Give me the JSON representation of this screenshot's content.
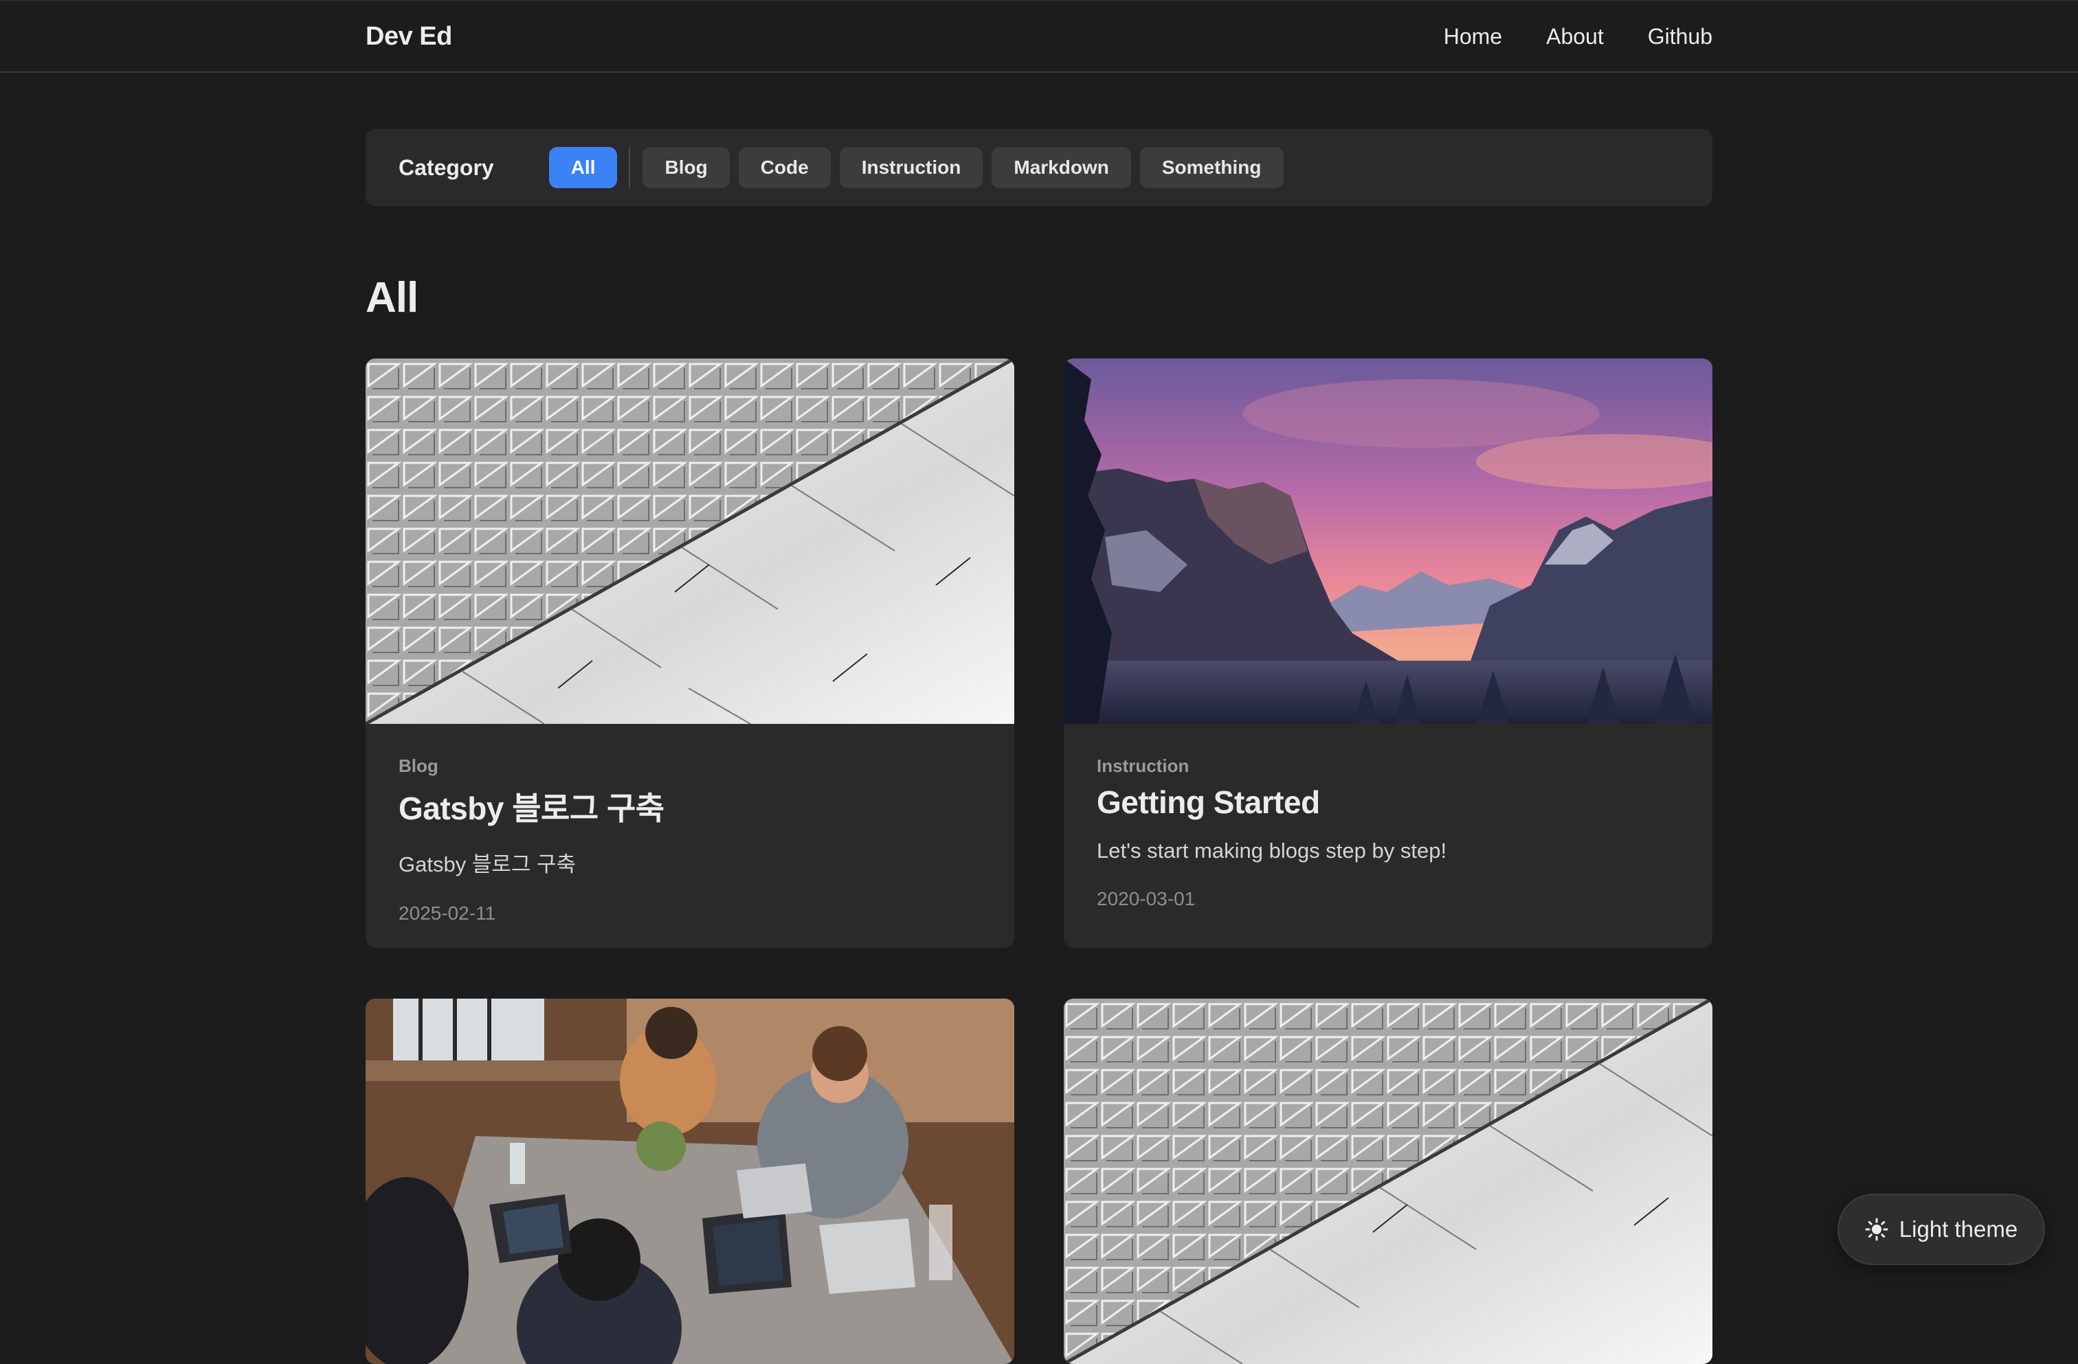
{
  "header": {
    "brand": "Dev Ed",
    "nav": [
      "Home",
      "About",
      "Github"
    ]
  },
  "categories": {
    "title": "Category",
    "items": [
      "All",
      "Blog",
      "Code",
      "Instruction",
      "Markdown",
      "Something"
    ],
    "selected": "All",
    "accent_color": "#3b82f6"
  },
  "section": {
    "title": "All"
  },
  "posts": [
    {
      "category": "Blog",
      "title": "Gatsby 블로그 구축",
      "summary": "Gatsby 블로그 구축",
      "date": "2025-02-11",
      "thumbnail": "architecture-facade-icon"
    },
    {
      "category": "Instruction",
      "title": "Getting Started",
      "summary": "Let's start making blogs step by step!",
      "date": "2020-03-01",
      "thumbnail": "mountain-sunset-icon"
    },
    {
      "category": "",
      "title": "",
      "summary": "",
      "date": "",
      "thumbnail": "team-working-laptops-icon"
    },
    {
      "category": "",
      "title": "",
      "summary": "",
      "date": "",
      "thumbnail": "architecture-facade-icon"
    }
  ],
  "theme_toggle": {
    "label": "Light theme",
    "icon": "sun-icon"
  }
}
